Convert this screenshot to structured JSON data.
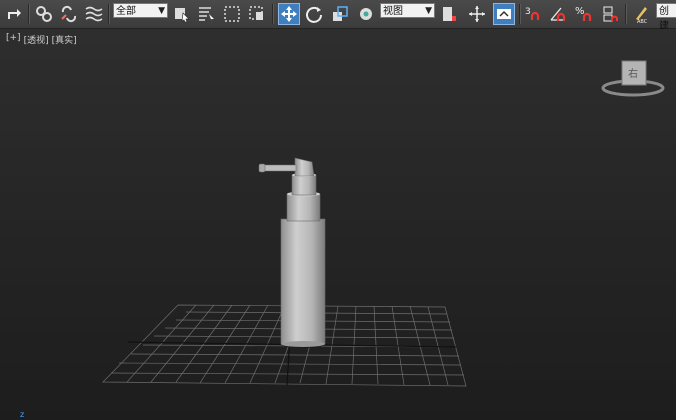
{
  "toolbar": {
    "selection_filter": "全部",
    "reference_coord": "视图",
    "create_selection_set": "创建"
  },
  "viewport": {
    "labels": [
      "[+]",
      "[透视]",
      "[真实]"
    ],
    "viewcube_face": "右",
    "axis_label": "z"
  },
  "colors": {
    "toolbar_bg": "#3c3c3c",
    "viewport_bg": "#2b2b2b",
    "active_tool": "#3f7fbf",
    "grid": "#7a7a7a",
    "object": "#bdbdbd"
  }
}
